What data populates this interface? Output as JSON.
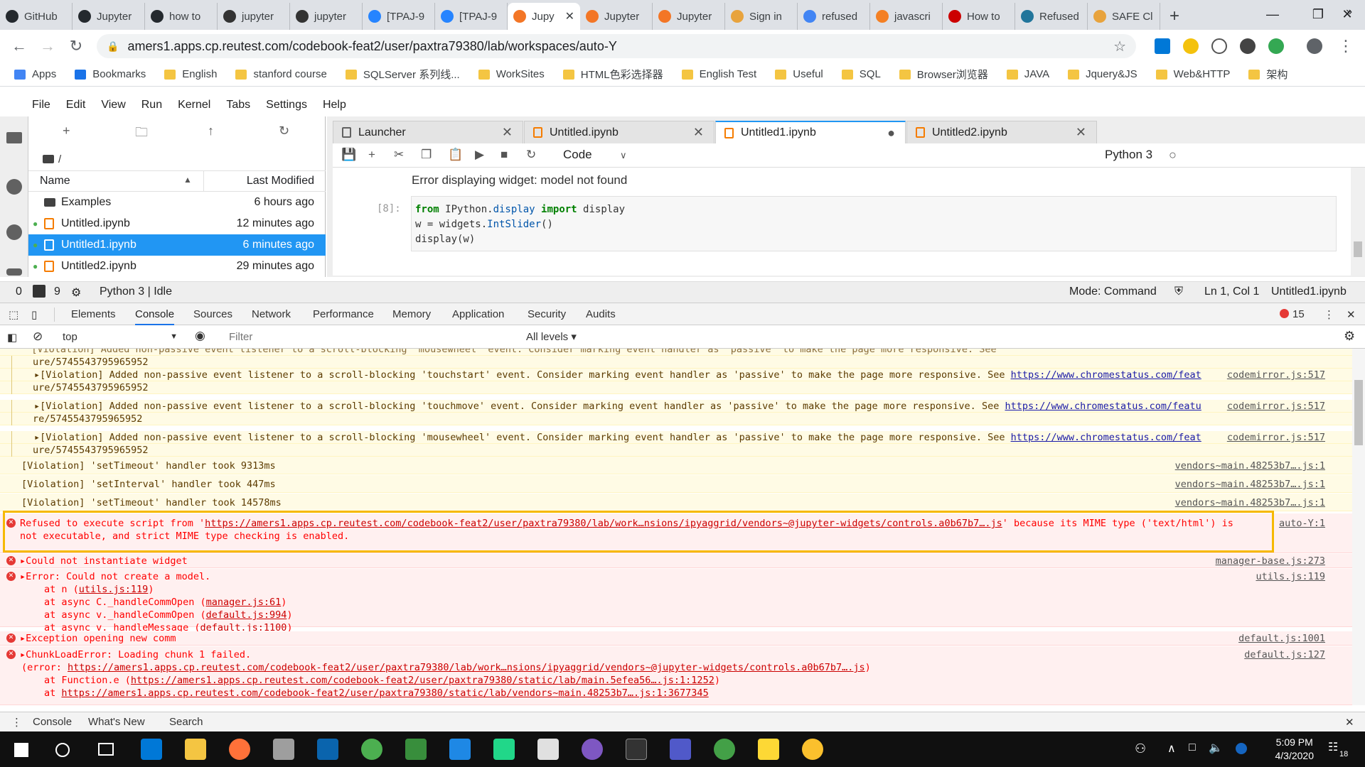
{
  "browser_tabs": [
    {
      "label": "GitHub",
      "color": "#24292e"
    },
    {
      "label": "Jupyter",
      "color": "#24292e"
    },
    {
      "label": "how to",
      "color": "#24292e"
    },
    {
      "label": "jupyter",
      "color": "#333333"
    },
    {
      "label": "jupyter",
      "color": "#333333"
    },
    {
      "label": "[TPAJ-9",
      "color": "#2684ff"
    },
    {
      "label": "[TPAJ-9",
      "color": "#2684ff"
    },
    {
      "label": "Jupy",
      "color": "#f37626",
      "active": true
    },
    {
      "label": "Jupyter",
      "color": "#f37626"
    },
    {
      "label": "Jupyter",
      "color": "#f37626"
    },
    {
      "label": "Sign in",
      "color": "#e8a33d"
    },
    {
      "label": "refused",
      "color": "#4285f4"
    },
    {
      "label": "javascri",
      "color": "#f48024"
    },
    {
      "label": "How to",
      "color": "#cc0000"
    },
    {
      "label": "Refused",
      "color": "#21759b"
    },
    {
      "label": "SAFE Cl",
      "color": "#e8a33d"
    }
  ],
  "address": {
    "url": "amers1.apps.cp.reutest.com/codebook-feat2/user/paxtra79380/lab/workspaces/auto-Y"
  },
  "bookmarks": [
    "Apps",
    "Bookmarks",
    "English",
    "stanford course",
    "SQLServer 系列线...",
    "WorkSites",
    "HTML色彩选择器",
    "English Test",
    "Useful",
    "SQL",
    "Browser浏览器",
    "JAVA",
    "Jquery&JS",
    "Web&HTTP",
    "架构"
  ],
  "menu": [
    "File",
    "Edit",
    "View",
    "Run",
    "Kernel",
    "Tabs",
    "Settings",
    "Help"
  ],
  "filebrowser": {
    "path": "/",
    "col_name": "Name",
    "col_modified": "Last Modified",
    "files": [
      {
        "name": "Examples",
        "modified": "6 hours ago",
        "type": "folder"
      },
      {
        "name": "Untitled.ipynb",
        "modified": "12 minutes ago",
        "type": "notebook",
        "running": true
      },
      {
        "name": "Untitled1.ipynb",
        "modified": "6 minutes ago",
        "type": "notebook",
        "running": true,
        "selected": true
      },
      {
        "name": "Untitled2.ipynb",
        "modified": "29 minutes ago",
        "type": "notebook",
        "running": true
      }
    ]
  },
  "notebook_tabs": [
    {
      "label": "Launcher"
    },
    {
      "label": "Untitled.ipynb"
    },
    {
      "label": "Untitled1.ipynb",
      "active": true
    },
    {
      "label": "Untitled2.ipynb"
    }
  ],
  "notebook": {
    "cell_type": "Code",
    "kernel": "Python 3",
    "output_text": "Error displaying widget: model not found",
    "prompt": "[8]:",
    "code_lines": [
      [
        "from",
        " IPython.",
        "display",
        " ",
        "import",
        " display"
      ],
      [
        "w = widgets.",
        "IntSlider",
        "()"
      ],
      [
        "display(w)"
      ]
    ]
  },
  "status": {
    "left_num": "0",
    "terminals": "9",
    "kernel_status": "Python 3 | Idle",
    "mode": "Mode: Command",
    "position": "Ln 1, Col 1",
    "file": "Untitled1.ipynb"
  },
  "devtools": {
    "tabs": [
      "Elements",
      "Console",
      "Sources",
      "Network",
      "Performance",
      "Memory",
      "Application",
      "Security",
      "Audits"
    ],
    "active_tab": "Console",
    "error_count": "15",
    "context": "top",
    "filter_placeholder": "Filter",
    "levels": "All levels ▾"
  },
  "console_lines": [
    {
      "kind": "warn",
      "text": "ure/5745543795965952",
      "src": ""
    },
    {
      "kind": "warn",
      "text": "▸[Violation] Added non-passive event listener to a scroll-blocking 'touchstart' event. Consider marking event handler as 'passive' to make the page more responsive. See ",
      "link": "https://www.chromestatus.com/feat",
      "src": "codemirror.js:517"
    },
    {
      "kind": "warn",
      "text": "ure/5745543795965952",
      "src": ""
    },
    {
      "kind": "warn",
      "text": "▸[Violation] Added non-passive event listener to a scroll-blocking 'touchmove' event. Consider marking event handler as 'passive' to make the page more responsive. See ",
      "link": "https://www.chromestatus.com/featu",
      "src": "codemirror.js:517"
    },
    {
      "kind": "warn",
      "text": "re/5745543795965952",
      "src": ""
    },
    {
      "kind": "warn",
      "text": "▸[Violation] Added non-passive event listener to a scroll-blocking 'mousewheel' event. Consider marking event handler as 'passive' to make the page more responsive. See ",
      "link": "https://www.chromestatus.com/feat",
      "src": "codemirror.js:517"
    },
    {
      "kind": "warn",
      "text": "ure/5745543795965952",
      "src": ""
    },
    {
      "kind": "warn",
      "text": "[Violation] 'setTimeout' handler took 9313ms",
      "src": "vendors~main.48253b7….js:1"
    },
    {
      "kind": "warn",
      "text": "[Violation] 'setInterval' handler took 447ms",
      "src": "vendors~main.48253b7….js:1"
    },
    {
      "kind": "warn",
      "text": "[Violation] 'setTimeout' handler took 14578ms",
      "src": "vendors~main.48253b7….js:1"
    }
  ],
  "refused_error": {
    "pre": "Refused to execute script from '",
    "link": "https://amers1.apps.cp.reutest.com/codebook-feat2/user/paxtra79380/lab/work…nsions/ipyaggrid/vendors~@jupyter-widgets/controls.a0b67b7….js",
    "post": "' because its MIME type ('text/html') is",
    "line2": "not executable, and strict MIME type checking is enabled.",
    "src": "auto-Y:1"
  },
  "errors": {
    "could_not_instantiate": "▸Could not instantiate widget",
    "could_not_instantiate_src": "manager-base.js:273",
    "create_model": "▸Error: Could not create a model.",
    "create_model_src": "utils.js:119",
    "stack1": "at n (",
    "stack1_link": "utils.js:119",
    "stack2": "at async C._handleCommOpen (",
    "stack2_link": "manager.js:61",
    "stack3": "at async v._handleCommOpen (",
    "stack3_link": "default.js:994",
    "stack4": "at async v._handleMessage (",
    "stack4_link": "default.js:1100",
    "exception": "▸Exception opening new comm",
    "exception_src": "default.js:1001",
    "chunk": "▸ChunkLoadError: Loading chunk 1 failed.",
    "chunk_src": "default.js:127",
    "chunk_err_pre": "(error: ",
    "chunk_err_link": "https://amers1.apps.cp.reutest.com/codebook-feat2/user/paxtra79380/lab/work…nsions/ipyaggrid/vendors~@jupyter-widgets/controls.a0b67b7….js",
    "chunk_err_post": ")",
    "chunk_at1": "at Function.e (",
    "chunk_at1_link": "https://amers1.apps.cp.reutest.com/codebook-feat2/user/paxtra79380/static/lab/main.5efea56….js:1:1252",
    "chunk_at2": "at ",
    "chunk_at2_link": "https://amers1.apps.cp.reutest.com/codebook-feat2/user/paxtra79380/static/lab/vendors~main.48253b7….js:1:3677345"
  },
  "drawer": [
    "Console",
    "What's New",
    "Search"
  ],
  "clock": {
    "time": "5:09 PM",
    "date": "4/3/2020",
    "notifications": "18"
  }
}
